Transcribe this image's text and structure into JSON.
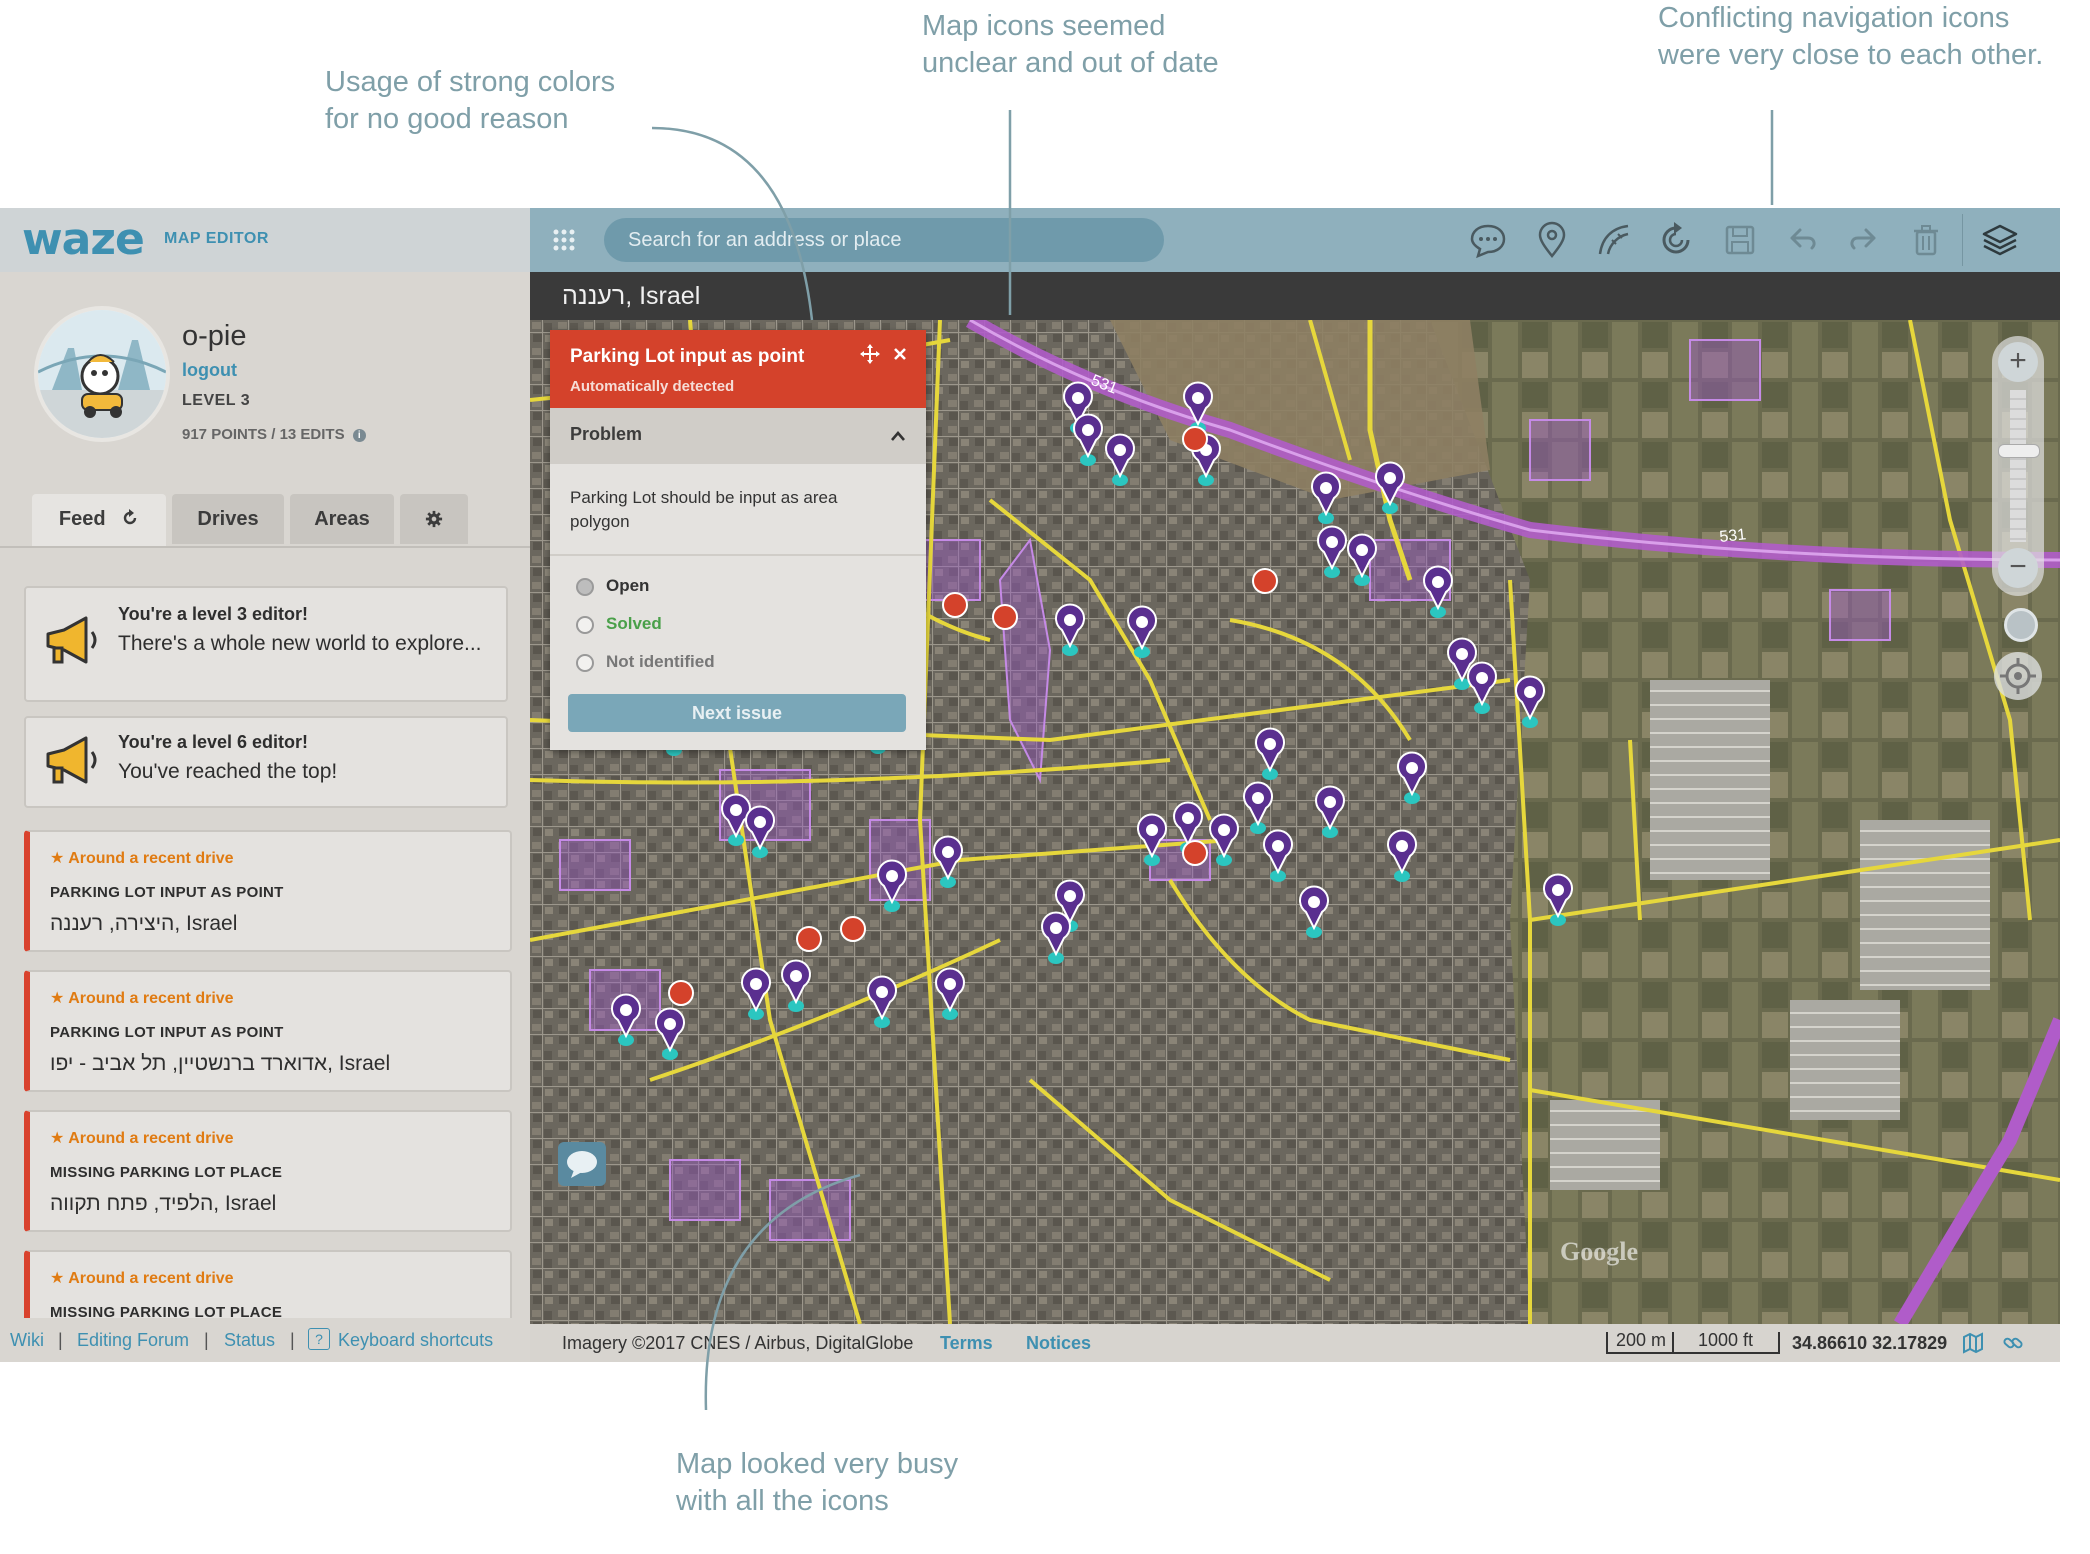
{
  "annotations": {
    "colors": "Usage of strong colors\nfor no good reason",
    "icons": "Map icons seemed\nunclear and out of date",
    "nav": "Conflicting navigation icons\nwere very close to each other.",
    "busy": "Map looked very busy\nwith all the icons"
  },
  "header": {
    "logo": "waze",
    "subtitle": "MAP EDITOR"
  },
  "user": {
    "name": "o-pie",
    "logout": "logout",
    "level": "LEVEL 3",
    "points": "917 POINTS",
    "edits": "13 EDITS",
    "separator": "/"
  },
  "tabs": {
    "feed": "Feed",
    "drives": "Drives",
    "areas": "Areas"
  },
  "feed": [
    {
      "title": "You're a level 3 editor!",
      "body": "There's a whole new world to explore..."
    },
    {
      "title": "You're a level 6 editor!",
      "body": "You've reached the top!"
    }
  ],
  "issues": [
    {
      "kind": "★ Around a recent drive",
      "title": "PARKING LOT INPUT AS POINT",
      "loc": "היצירה, רעננה, Israel"
    },
    {
      "kind": "★ Around a recent drive",
      "title": "PARKING LOT INPUT AS POINT",
      "loc": "אדוארד ברנשטיין, תל אביב - יפו, Israel"
    },
    {
      "kind": "★ Around a recent drive",
      "title": "MISSING PARKING LOT PLACE",
      "loc": "הלפיד, פתח תקווה, Israel"
    },
    {
      "kind": "★ Around a recent drive",
      "title": "MISSING PARKING LOT PLACE",
      "loc": ""
    }
  ],
  "footer": {
    "wiki": "Wiki",
    "forum": "Editing Forum",
    "status": "Status",
    "shortcuts": "Keyboard shortcuts",
    "sep": "|",
    "shortcut_key": "?"
  },
  "search": {
    "placeholder": "Search for an address or place"
  },
  "city": "רעננה, Israel",
  "panel": {
    "title": "Parking Lot input as point",
    "subtitle": "Automatically detected",
    "section": "Problem",
    "description": "Parking Lot should be input as area polygon",
    "options": [
      "Open",
      "Solved",
      "Not identified"
    ],
    "button": "Next issue"
  },
  "status": {
    "imagery": "Imagery ©2017 CNES / Airbus, DigitalGlobe",
    "terms": "Terms",
    "notices": "Notices",
    "scale_m": "200 m",
    "scale_ft": "1000 ft",
    "coords": "34.86610 32.17829"
  },
  "map": {
    "road_label": "531",
    "google": "Google"
  },
  "colors": {
    "accent": "#3e90b1",
    "issue": "#d4422b",
    "pin": "#5a2f8f",
    "pin_base": "#2bc6c0",
    "highway": "#b05cc9",
    "road": "#e8d840"
  }
}
